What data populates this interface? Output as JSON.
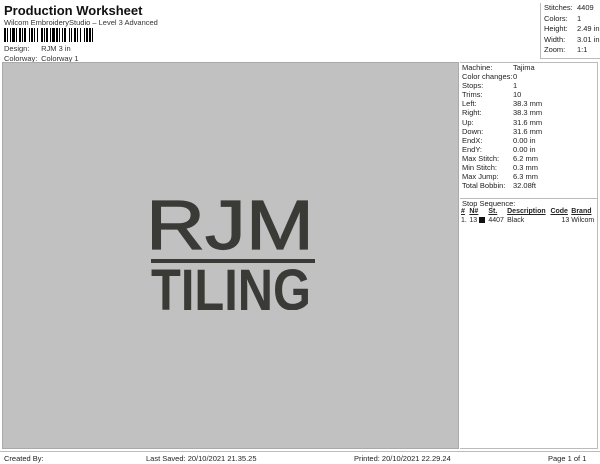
{
  "header": {
    "title": "Production Worksheet",
    "subtitle": "Wilcom EmbroideryStudio – Level 3 Advanced"
  },
  "design_info": {
    "design_label": "Design:",
    "design_value": "RJM 3 in",
    "colorway_label": "Colorway:",
    "colorway_value": "Colorway 1"
  },
  "summary": [
    {
      "k": "Stitches:",
      "v": "4409"
    },
    {
      "k": "Colors:",
      "v": "1"
    },
    {
      "k": "Height:",
      "v": "2.49 in"
    },
    {
      "k": "Width:",
      "v": "3.01 in"
    },
    {
      "k": "Zoom:",
      "v": "1:1"
    }
  ],
  "details": [
    {
      "k": "Machine:",
      "v": "Tajima"
    },
    {
      "k": "Color changes:",
      "v": "0"
    },
    {
      "k": "Stops:",
      "v": "1"
    },
    {
      "k": "Trims:",
      "v": "10"
    },
    {
      "k": "Left:",
      "v": "38.3 mm"
    },
    {
      "k": "Right:",
      "v": "38.3 mm"
    },
    {
      "k": "Up:",
      "v": "31.6 mm"
    },
    {
      "k": "Down:",
      "v": "31.6 mm"
    },
    {
      "k": "EndX:",
      "v": "0.00 in"
    },
    {
      "k": "EndY:",
      "v": "0.00 in"
    },
    {
      "k": "Max Stitch:",
      "v": "6.2 mm"
    },
    {
      "k": "Min Stitch:",
      "v": "0.3 mm"
    },
    {
      "k": "Max Jump:",
      "v": "6.3 mm"
    },
    {
      "k": "Total Bobbin:",
      "v": "32.08ft"
    }
  ],
  "stop_sequence": {
    "title": "Stop Sequence:",
    "columns": [
      "#",
      "N#",
      "St.",
      "Description",
      "Code",
      "Brand"
    ],
    "rows": [
      {
        "num": "1.",
        "n": "13",
        "st": "4407",
        "desc": "Black",
        "code": "13",
        "brand": "Wilcom",
        "color": "#111111"
      }
    ]
  },
  "design": {
    "line1": "RJM",
    "line2": "TILING",
    "background": "#c1c1c1",
    "thread_color": "#3a3a36"
  },
  "footer": {
    "created": "Created By:",
    "last_saved": "Last Saved: 20/10/2021 21.35.25",
    "printed": "Printed: 20/10/2021 22.29.24",
    "page": "Page 1 of 1"
  }
}
